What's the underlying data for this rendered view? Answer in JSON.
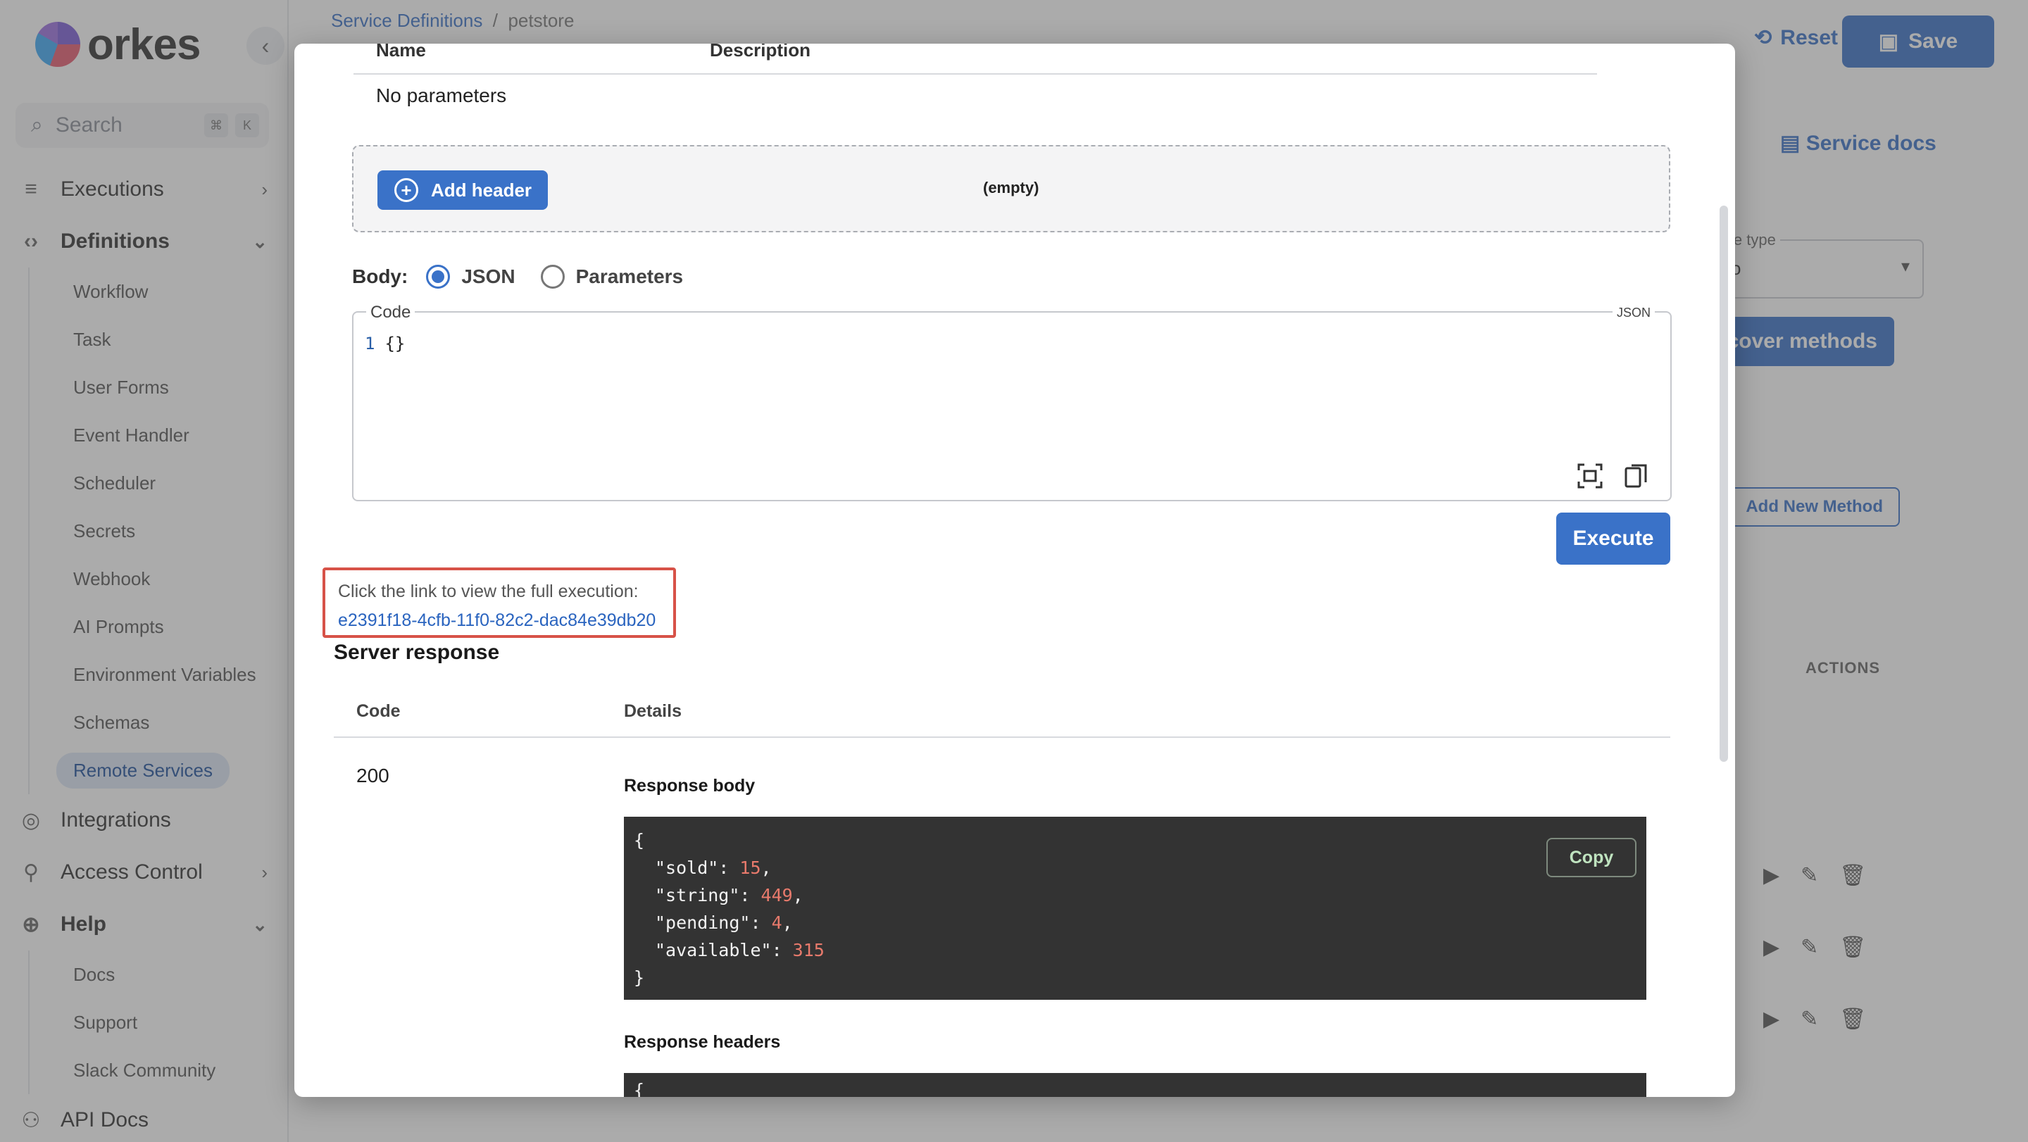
{
  "app": {
    "logo_text": "orkes",
    "search_placeholder": "Search",
    "search_shortcut": [
      "⌘",
      "K"
    ],
    "nav": [
      {
        "label": "Executions",
        "icon": "executions-icon"
      },
      {
        "label": "Definitions",
        "icon": "code-icon"
      },
      {
        "label": "Integrations",
        "icon": "integrations-icon"
      },
      {
        "label": "Access Control",
        "icon": "access-control-icon"
      },
      {
        "label": "Help",
        "icon": "help-icon"
      },
      {
        "label": "API Docs",
        "icon": "api-docs-icon"
      }
    ],
    "definitions_sub": [
      "Workflow",
      "Task",
      "User Forms",
      "Event Handler",
      "Scheduler",
      "Secrets",
      "Webhook",
      "AI Prompts",
      "Environment Variables",
      "Schemas",
      "Remote Services"
    ],
    "help_sub": [
      "Docs",
      "Support",
      "Slack Community"
    ],
    "breadcrumb": {
      "parent": "Service Definitions",
      "separator": "/",
      "current": "petstore"
    },
    "reset_label": "Reset",
    "save_label": "Save",
    "service_docs_label": "Service docs",
    "service_type_label": "ice type",
    "service_type_value": "o",
    "discover_label": "cover methods",
    "add_method_label": "Add New Method",
    "actions_label": "ACTIONS"
  },
  "modal": {
    "params_columns": {
      "name": "Name",
      "description": "Description"
    },
    "no_params": "No parameters",
    "add_header_label": "Add header",
    "headers_empty": "(empty)",
    "body_label": "Body:",
    "body_options": {
      "json": "JSON",
      "parameters": "Parameters"
    },
    "body_selected": "JSON",
    "code_legend": "Code",
    "code_lang": "JSON",
    "code_line_no": "1",
    "code_text": "{}",
    "execute_label": "Execute",
    "exec_link_text": "Click the link to view the full execution:",
    "exec_link_id": "e2391f18-4cfb-11f0-82c2-dac84e39db20",
    "server_response_title": "Server response",
    "response_columns": {
      "code": "Code",
      "details": "Details"
    },
    "response_code": "200",
    "response_body_label": "Response body",
    "response_body": {
      "open": "{",
      "lines": [
        {
          "key": "\"sold\": ",
          "value": "15",
          "sep": ","
        },
        {
          "key": "\"string\": ",
          "value": "449",
          "sep": ","
        },
        {
          "key": "\"pending\": ",
          "value": "4",
          "sep": ","
        },
        {
          "key": "\"available\": ",
          "value": "315",
          "sep": ""
        }
      ],
      "close": "}"
    },
    "copy_label": "Copy",
    "response_headers_label": "Response headers",
    "response_headers_open": "{"
  },
  "colors": {
    "accent": "#3a72c8",
    "highlight_border": "#d75248",
    "code_bg": "#333333",
    "number": "#e87a6c"
  }
}
